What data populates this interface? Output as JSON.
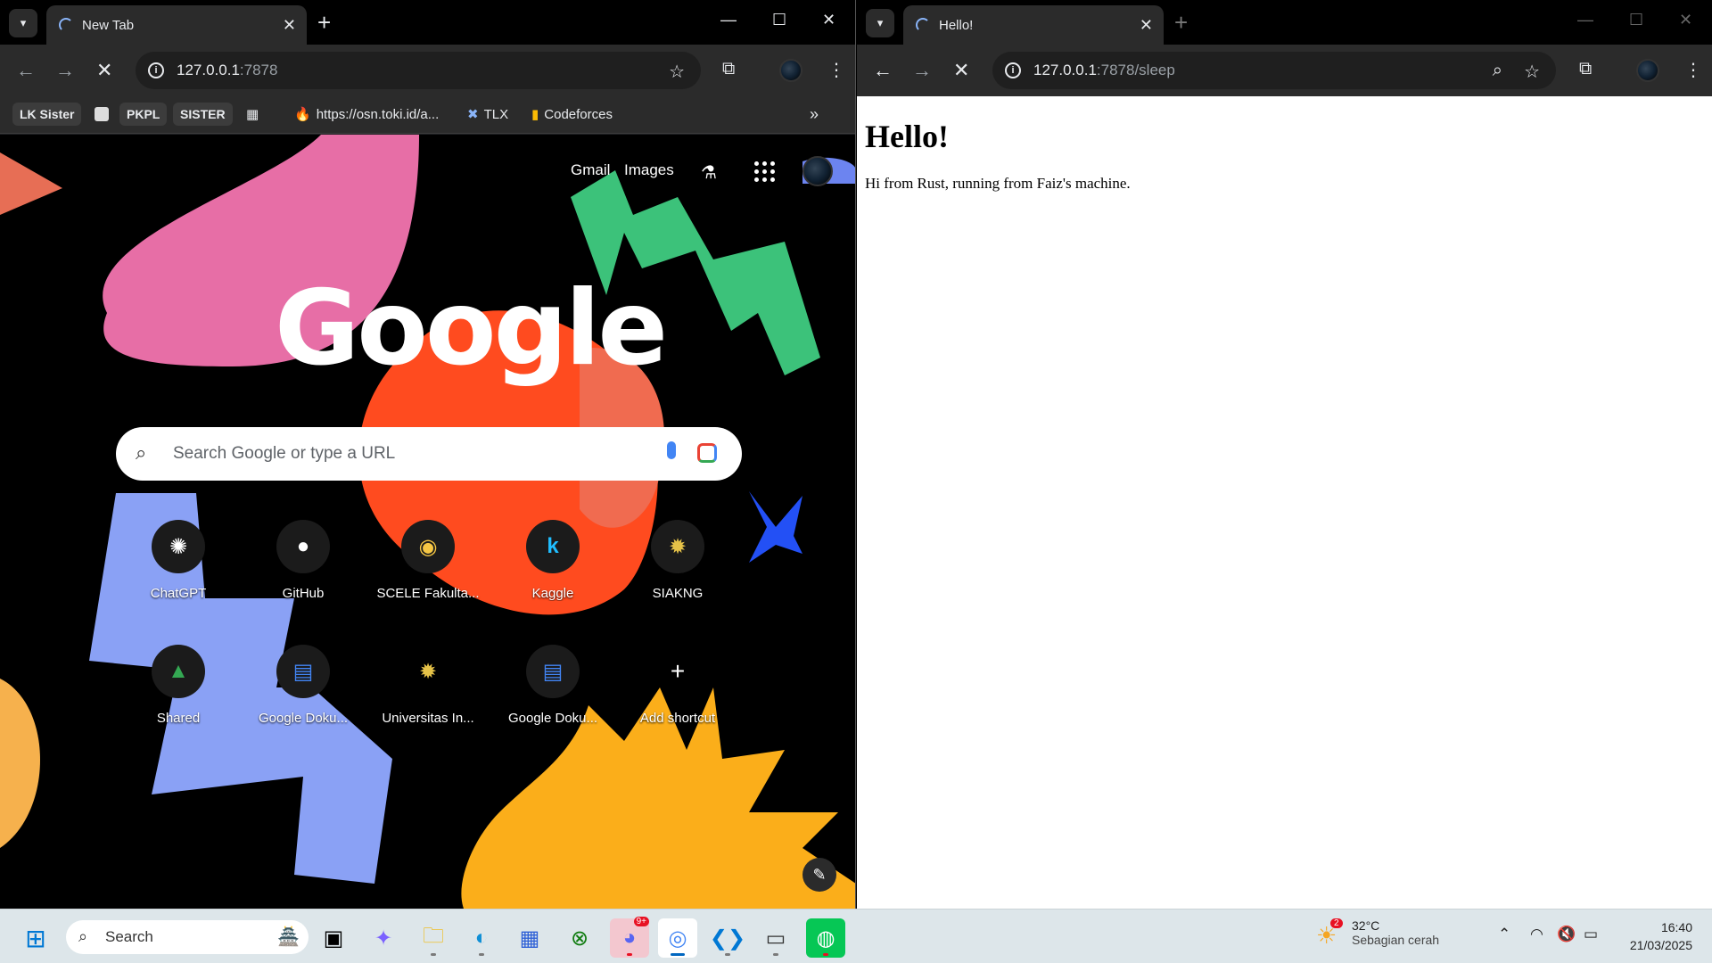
{
  "left_window": {
    "tab_title": "New Tab",
    "url_host": "127.0.0.1",
    "url_path": ":7878",
    "bookmarks": [
      "LK Sister",
      "PKPL",
      "SISTER",
      "https://osn.toki.id/a...",
      "TLX",
      "Codeforces"
    ],
    "ntp": {
      "top_links": [
        "Gmail",
        "Images"
      ],
      "logo_text": "Google",
      "search_placeholder": "Search Google or type a URL",
      "shortcuts_row1": [
        {
          "label": "ChatGPT",
          "icon": "chatgpt-icon"
        },
        {
          "label": "GitHub",
          "icon": "github-icon"
        },
        {
          "label": "SCELE Fakulta...",
          "icon": "scele-icon"
        },
        {
          "label": "Kaggle",
          "icon": "kaggle-icon"
        },
        {
          "label": "SIAKNG",
          "icon": "siakng-icon"
        }
      ],
      "shortcuts_row2": [
        {
          "label": "Shared",
          "icon": "drive-icon"
        },
        {
          "label": "Google Doku...",
          "icon": "docs-icon"
        },
        {
          "label": "Universitas In...",
          "icon": "ui-icon"
        },
        {
          "label": "Google Doku...",
          "icon": "docs-icon"
        },
        {
          "label": "Add shortcut",
          "icon": "plus-icon"
        }
      ]
    }
  },
  "right_window": {
    "tab_title": "Hello!",
    "url_host": "127.0.0.1",
    "url_path": ":7878/sleep",
    "heading": "Hello!",
    "paragraph": "Hi from Rust, running from Faiz's machine."
  },
  "taskbar": {
    "search_label": "Search",
    "weather_badge": "2",
    "temperature": "32°C",
    "weather_text": "Sebagian cerah",
    "time": "16:40",
    "date": "21/03/2025",
    "discord_badge": "9+"
  },
  "colors": {
    "accent_blue": "#8ab4f8",
    "chrome_dark": "#2b2b2b",
    "pink": "#e76ea6",
    "green": "#3cc27a",
    "orange_red": "#ff4b1f",
    "periwinkle": "#8aa1f5",
    "yellow": "#fbae1a"
  }
}
